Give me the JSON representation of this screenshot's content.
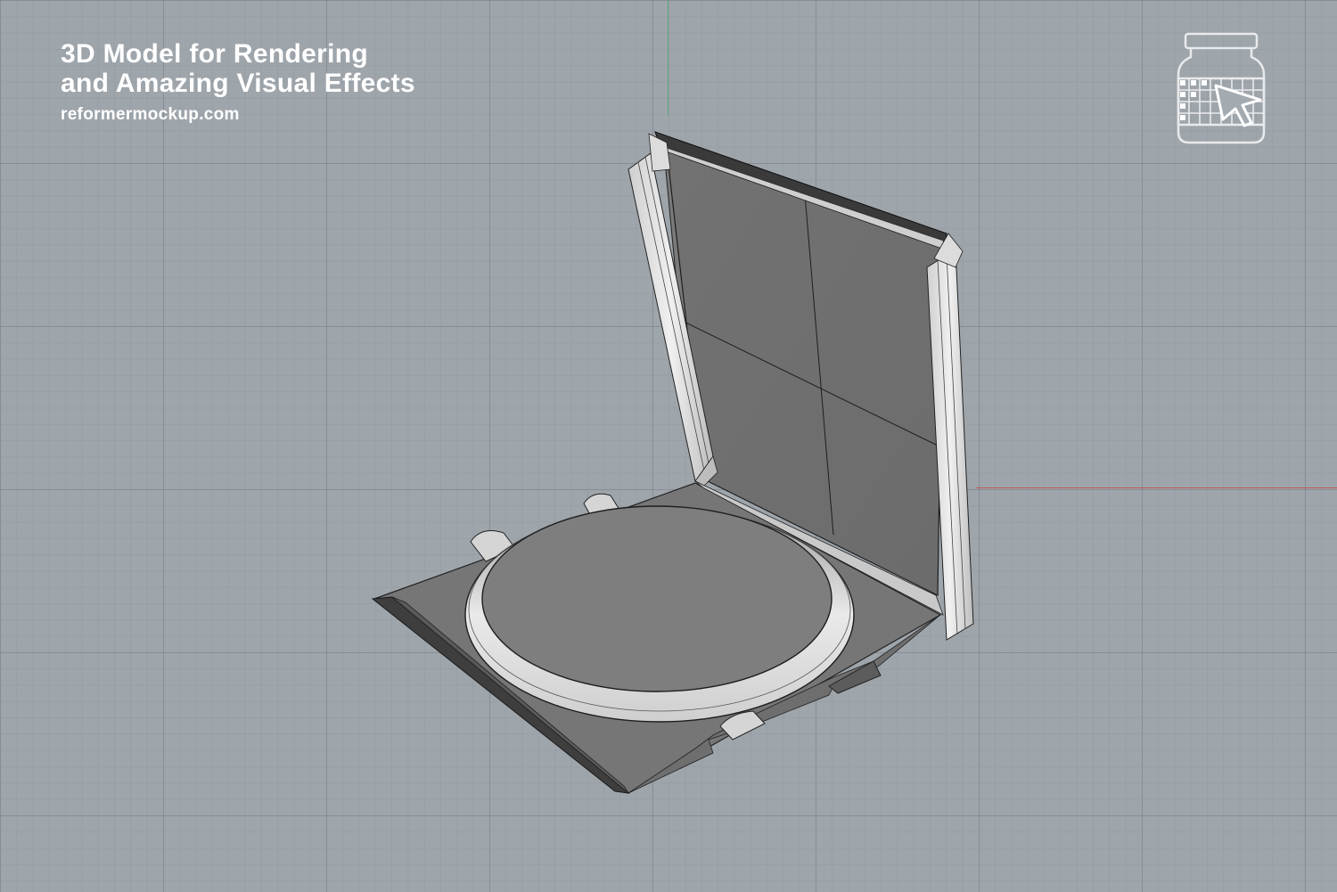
{
  "caption": {
    "line1": "3D Model for Rendering",
    "line2": "and Amazing Visual Effects",
    "url": "reformermockup.com"
  },
  "colors": {
    "background": "#9ea5ab",
    "grid": "#7d858c",
    "axis_x": "#c45a5a",
    "axis_y": "#5aa77a",
    "text": "#ffffff",
    "box_surface": "#7a7a7a",
    "box_edge": "#e6e6e6"
  },
  "icons": {
    "logo": "jar-grid-cursor-icon"
  },
  "model": {
    "name": "pizza-box-open"
  }
}
